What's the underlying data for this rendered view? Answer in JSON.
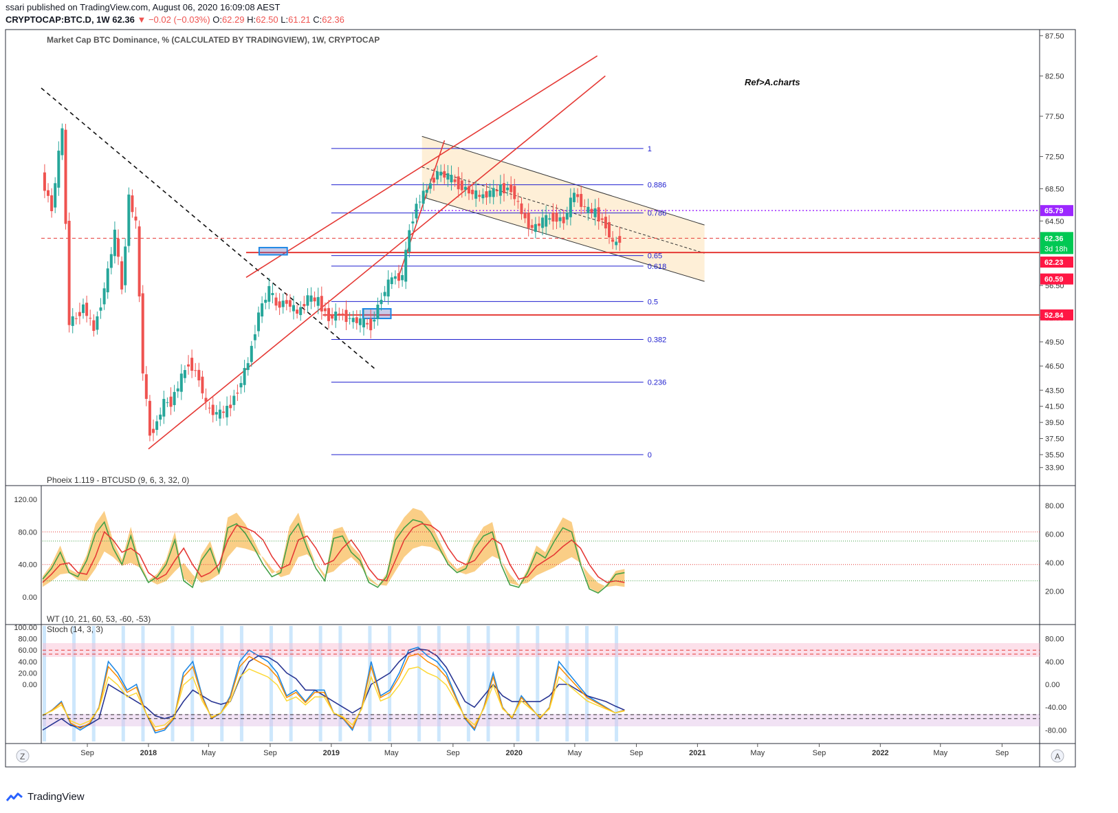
{
  "header": {
    "published": "ssari published on TradingView.com, August 06, 2020 16:09:08 AEST",
    "symbol": "CRYPTOCAP:BTC.D, 1W",
    "last": "62.36",
    "change": "▼ −0.02 (−0.03%)",
    "o_label": "O:",
    "o": "62.29",
    "h_label": "H:",
    "h": "62.50",
    "l_label": "L:",
    "l": "61.21",
    "c_label": "C:",
    "c": "62.36"
  },
  "footer": {
    "brand": "TradingView"
  },
  "colors": {
    "up": "#26a69a",
    "down": "#ef5350",
    "fib": "#1e1ecf",
    "trend": "#e53935",
    "channel_fill": "#fde9c9",
    "purple": "#9c27ff",
    "orange_band": "#f5a623",
    "green_line": "#43a047",
    "blue_line": "#1e88e5",
    "navy_line": "#283593",
    "gold_line": "#fdd835",
    "vwap_band": "#9fa8da"
  },
  "chart_data": [
    {
      "type": "candlestick",
      "title": "Market Cap BTC Dominance, % (CALCULATED BY TRADINGVIEW), 1W, CRYPTOCAP",
      "annotation": "Ref>A.charts",
      "ylim": [
        32.0,
        88.0
      ],
      "y_ticks": [
        33.9,
        35.5,
        37.5,
        39.5,
        41.5,
        43.5,
        46.5,
        49.5,
        52.5,
        56.5,
        64.5,
        68.5,
        72.5,
        77.5,
        82.5,
        87.5
      ],
      "y_tick_labels": [
        "33.90",
        "35.50",
        "37.50",
        "39.50",
        "41.50",
        "43.50",
        "46.50",
        "49.50",
        "52.50",
        "56.50",
        "64.50",
        "68.50",
        "72.50",
        "77.50",
        "82.50",
        "87.50"
      ],
      "x_range": [
        "2017-06-01",
        "2022-11-15"
      ],
      "x_ticks": [
        "2017-09-01",
        "2018-01-01",
        "2018-05-01",
        "2018-09-01",
        "2019-01-01",
        "2019-05-01",
        "2019-09-01",
        "2020-01-01",
        "2020-05-01",
        "2020-09-01",
        "2021-01-01",
        "2021-05-01",
        "2021-09-01",
        "2022-01-01",
        "2022-05-01",
        "2022-09-01"
      ],
      "x_tick_labels": [
        "Sep",
        "2018",
        "May",
        "Sep",
        "2019",
        "May",
        "Sep",
        "2020",
        "May",
        "Sep",
        "2021",
        "May",
        "Sep",
        "2022",
        "May",
        "Sep"
      ],
      "series_close": [
        [
          "2017-06-05",
          70.0
        ],
        [
          "2017-06-26",
          66.0
        ],
        [
          "2017-07-17",
          76.0
        ],
        [
          "2017-07-31",
          52.0
        ],
        [
          "2017-08-14",
          52.5
        ],
        [
          "2017-08-28",
          54.0
        ],
        [
          "2017-09-18",
          51.0
        ],
        [
          "2017-10-09",
          56.0
        ],
        [
          "2017-10-30",
          63.0
        ],
        [
          "2017-11-13",
          56.0
        ],
        [
          "2017-11-27",
          67.5
        ],
        [
          "2017-12-11",
          64.0
        ],
        [
          "2017-12-25",
          46.0
        ],
        [
          "2018-01-08",
          38.0
        ],
        [
          "2018-01-22",
          39.5
        ],
        [
          "2018-02-05",
          42.0
        ],
        [
          "2018-02-19",
          42.0
        ],
        [
          "2018-03-05",
          44.0
        ],
        [
          "2018-03-26",
          47.0
        ],
        [
          "2018-04-16",
          45.0
        ],
        [
          "2018-04-30",
          41.5
        ],
        [
          "2018-05-21",
          40.5
        ],
        [
          "2018-06-11",
          41.0
        ],
        [
          "2018-07-02",
          43.5
        ],
        [
          "2018-07-23",
          47.0
        ],
        [
          "2018-08-13",
          53.0
        ],
        [
          "2018-09-03",
          56.0
        ],
        [
          "2018-09-17",
          54.0
        ],
        [
          "2018-10-08",
          54.5
        ],
        [
          "2018-10-29",
          53.0
        ],
        [
          "2018-11-19",
          55.0
        ],
        [
          "2018-12-10",
          54.5
        ],
        [
          "2018-12-31",
          52.5
        ],
        [
          "2019-01-21",
          53.0
        ],
        [
          "2019-02-11",
          52.3
        ],
        [
          "2019-03-04",
          52.0
        ],
        [
          "2019-03-25",
          51.5
        ],
        [
          "2019-04-15",
          55.0
        ],
        [
          "2019-05-06",
          57.5
        ],
        [
          "2019-05-27",
          57.5
        ],
        [
          "2019-06-10",
          63.5
        ],
        [
          "2019-06-24",
          66.5
        ],
        [
          "2019-07-15",
          68.5
        ],
        [
          "2019-08-05",
          70.5
        ],
        [
          "2019-08-26",
          70.0
        ],
        [
          "2019-09-16",
          69.0
        ],
        [
          "2019-10-07",
          68.2
        ],
        [
          "2019-10-28",
          67.5
        ],
        [
          "2019-11-18",
          68.0
        ],
        [
          "2019-12-09",
          68.5
        ],
        [
          "2019-12-30",
          68.5
        ],
        [
          "2020-01-20",
          65.5
        ],
        [
          "2020-02-10",
          63.5
        ],
        [
          "2020-03-02",
          64.5
        ],
        [
          "2020-03-23",
          65.0
        ],
        [
          "2020-04-13",
          64.5
        ],
        [
          "2020-05-04",
          68.0
        ],
        [
          "2020-05-25",
          66.0
        ],
        [
          "2020-06-15",
          65.5
        ],
        [
          "2020-07-06",
          64.0
        ],
        [
          "2020-07-20",
          61.5
        ],
        [
          "2020-08-03",
          62.36
        ]
      ],
      "horizontal_levels": [
        {
          "value": 60.59,
          "label": "60.59",
          "color": "red"
        },
        {
          "value": 52.84,
          "label": "52.84",
          "color": "red"
        },
        {
          "value": 65.79,
          "label": "65.79",
          "color": "purple"
        },
        {
          "value": 62.36,
          "label": "62.36",
          "color": "dashed-red"
        }
      ],
      "fibonacci": [
        {
          "ratio": "1",
          "value": 73.5
        },
        {
          "ratio": "0.886",
          "value": 69.0
        },
        {
          "ratio": "0.786",
          "value": 65.5
        },
        {
          "ratio": "0.65",
          "value": 60.2
        },
        {
          "ratio": "0.618",
          "value": 58.9
        },
        {
          "ratio": "0.5",
          "value": 54.5
        },
        {
          "ratio": "0.382",
          "value": 49.8
        },
        {
          "ratio": "0.236",
          "value": 44.5
        },
        {
          "ratio": "0",
          "value": 35.5
        }
      ],
      "price_tags": [
        {
          "label": "62.36",
          "sub": "3d 18h",
          "color": "green"
        },
        {
          "label": "62.23",
          "color": "red"
        },
        {
          "label": "60.59",
          "color": "red"
        },
        {
          "label": "52.84",
          "color": "red"
        },
        {
          "label": "65.79",
          "color": "purple"
        }
      ]
    },
    {
      "type": "line",
      "title": "Phoeix 1.119 - BTCUSD (9, 6, 3, 32, 0)",
      "left_ticks": [
        "120.00",
        "80.00",
        "40.00",
        "0.00"
      ],
      "left_values": [
        120,
        80,
        40,
        0
      ],
      "right_ticks": [
        "80.00",
        "60.00",
        "40.00",
        "20.00"
      ],
      "right_values": [
        80,
        60,
        40,
        20
      ],
      "series": [
        {
          "values": [
            22,
            35,
            55,
            30,
            25,
            45,
            78,
            92,
            60,
            40,
            75,
            38,
            18,
            25,
            40,
            70,
            20,
            12,
            45,
            60,
            30,
            85,
            90,
            78,
            60,
            40,
            25,
            30,
            75,
            90,
            60,
            35,
            20,
            72,
            75,
            55,
            45,
            18,
            12,
            25,
            70,
            85,
            95,
            92,
            80,
            60,
            40,
            30,
            35,
            60,
            75,
            80,
            40,
            15,
            12,
            30,
            55,
            48,
            68,
            85,
            80,
            40,
            10,
            5,
            14,
            28,
            30
          ]
        },
        {
          "values": [
            18,
            28,
            40,
            42,
            30,
            28,
            50,
            80,
            70,
            55,
            60,
            52,
            30,
            22,
            28,
            45,
            60,
            40,
            25,
            30,
            40,
            70,
            88,
            85,
            80,
            70,
            50,
            35,
            40,
            70,
            75,
            60,
            40,
            45,
            60,
            70,
            55,
            35,
            22,
            20,
            45,
            70,
            85,
            90,
            88,
            80,
            60,
            45,
            40,
            45,
            60,
            72,
            65,
            40,
            22,
            25,
            38,
            45,
            52,
            62,
            70,
            60,
            40,
            25,
            18,
            20,
            18
          ]
        }
      ]
    },
    {
      "type": "line",
      "title": "WT (10, 21, 60, 53, -60, -53)",
      "subtitle": "Stoch (14, 3, 3)",
      "left_ticks": [
        "100.00",
        "80.00",
        "60.00",
        "40.00",
        "20.00",
        "0.00"
      ],
      "left_values": [
        100,
        80,
        60,
        40,
        20,
        0
      ],
      "right_ticks": [
        "80.00",
        "40.00",
        "0.00",
        "-40.00",
        "-80.00"
      ],
      "right_values": [
        80,
        40,
        0,
        -40,
        -80
      ],
      "series": [
        {
          "values": [
            -55,
            -45,
            -30,
            -70,
            -80,
            -70,
            -40,
            40,
            20,
            -10,
            0,
            -50,
            -85,
            -80,
            -60,
            20,
            40,
            -20,
            -60,
            -50,
            -20,
            40,
            60,
            50,
            40,
            20,
            -20,
            -10,
            -30,
            -10,
            -10,
            -50,
            -60,
            -80,
            -40,
            40,
            -20,
            -10,
            20,
            60,
            65,
            50,
            40,
            20,
            -20,
            -60,
            -80,
            -40,
            20,
            -40,
            -60,
            -20,
            -40,
            -60,
            -40,
            40,
            20,
            0,
            -20,
            -30,
            -40,
            -50,
            -45
          ]
        },
        {
          "values": [
            -80,
            -70,
            -60,
            -72,
            -75,
            -70,
            -60,
            0,
            -10,
            -20,
            -30,
            -40,
            -55,
            -60,
            -55,
            -30,
            -10,
            -20,
            -30,
            -35,
            -30,
            10,
            40,
            50,
            48,
            38,
            20,
            10,
            -10,
            -10,
            -20,
            -30,
            -40,
            -50,
            -40,
            0,
            10,
            20,
            40,
            55,
            62,
            60,
            50,
            30,
            0,
            -30,
            -40,
            -20,
            0,
            -20,
            -30,
            -30,
            -30,
            -30,
            -20,
            0,
            0,
            -10,
            -20,
            -25,
            -30,
            -38,
            -45
          ]
        }
      ]
    }
  ]
}
